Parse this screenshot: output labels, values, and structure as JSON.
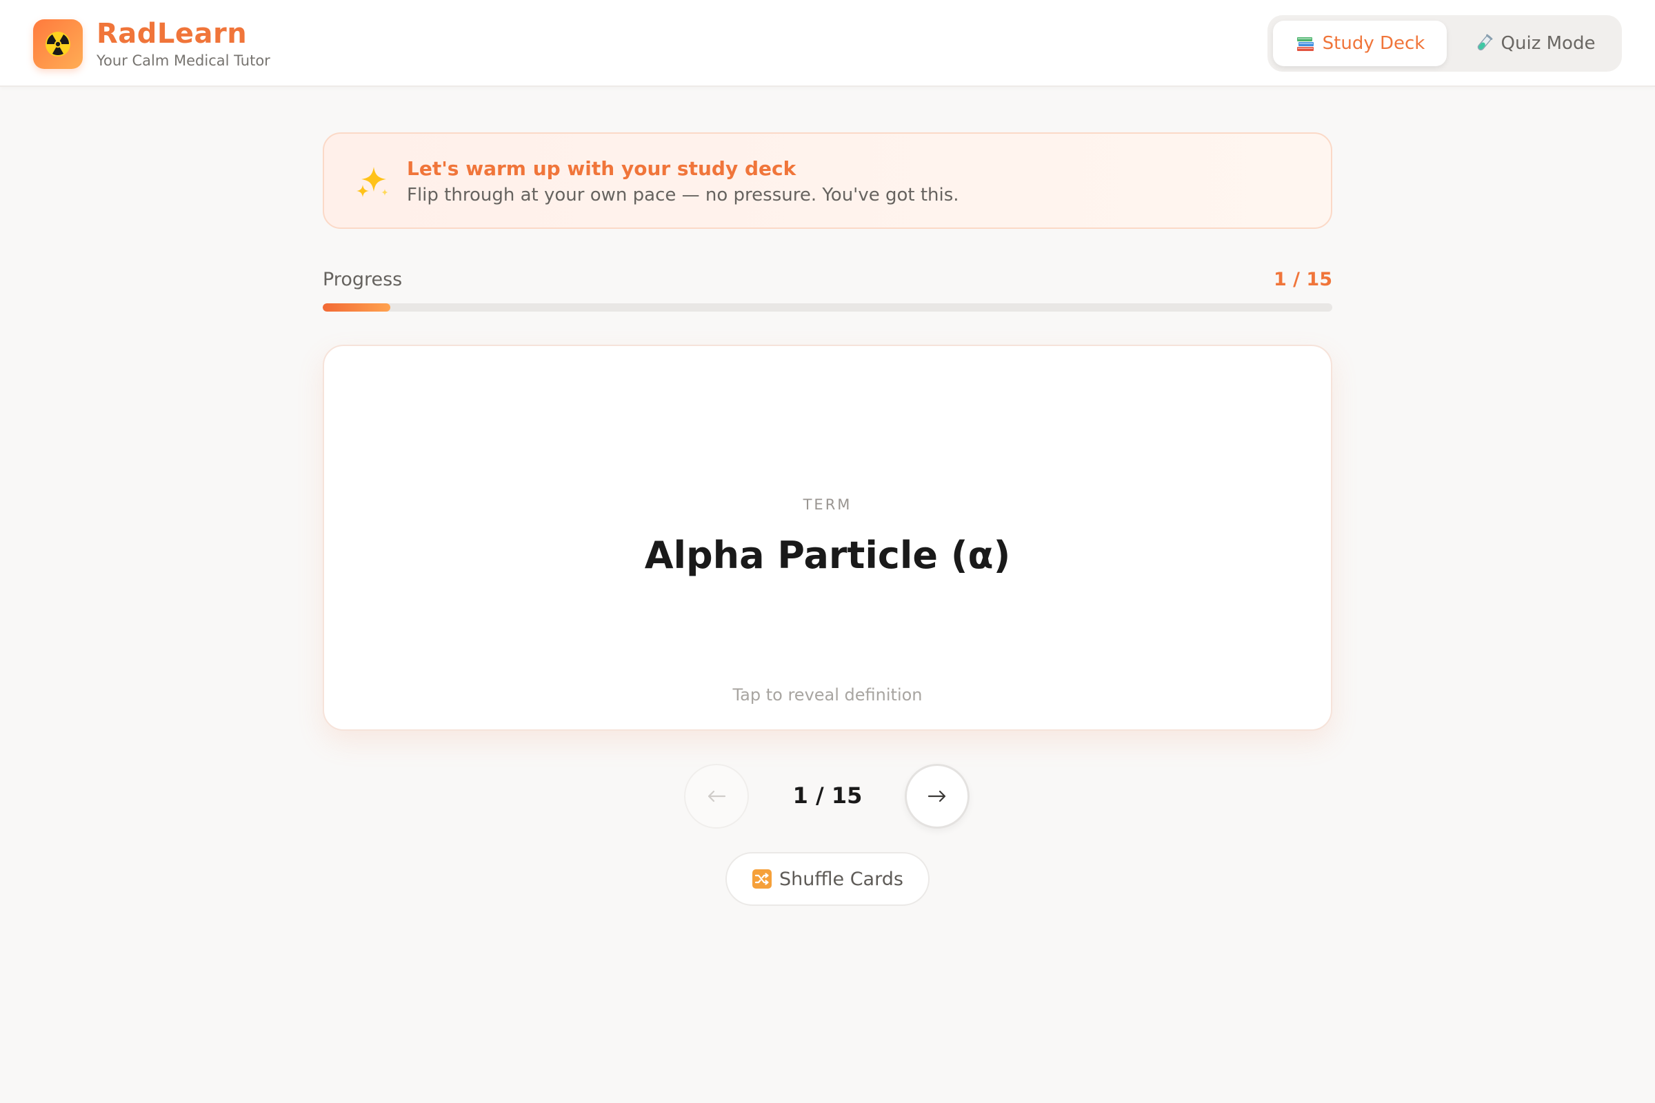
{
  "app": {
    "name": "RadLearn",
    "tagline": "Your Calm Medical Tutor",
    "logo_icon": "radiation-icon",
    "accent_color": "#f0753a"
  },
  "mode_switch": {
    "study": {
      "label": "Study Deck",
      "icon": "books-icon",
      "active": true
    },
    "quiz": {
      "label": "Quiz Mode",
      "icon": "test-tube-icon",
      "active": false
    }
  },
  "banner": {
    "icon": "sparkles-icon",
    "title": "Let's warm up with your study deck",
    "subtitle": "Flip through at your own pace — no pressure. You've got this."
  },
  "progress": {
    "label": "Progress",
    "count_text": "1 / 15",
    "current": 1,
    "total": 15,
    "fraction": 0.0667
  },
  "flashcard": {
    "kind": "TERM",
    "term": "Alpha Particle (α)",
    "hint": "Tap to reveal definition"
  },
  "navigation": {
    "prev_icon": "arrow-left-icon",
    "next_icon": "arrow-right-icon",
    "counter": "1 / 15"
  },
  "shuffle": {
    "label": "Shuffle Cards",
    "icon": "shuffle-icon"
  }
}
